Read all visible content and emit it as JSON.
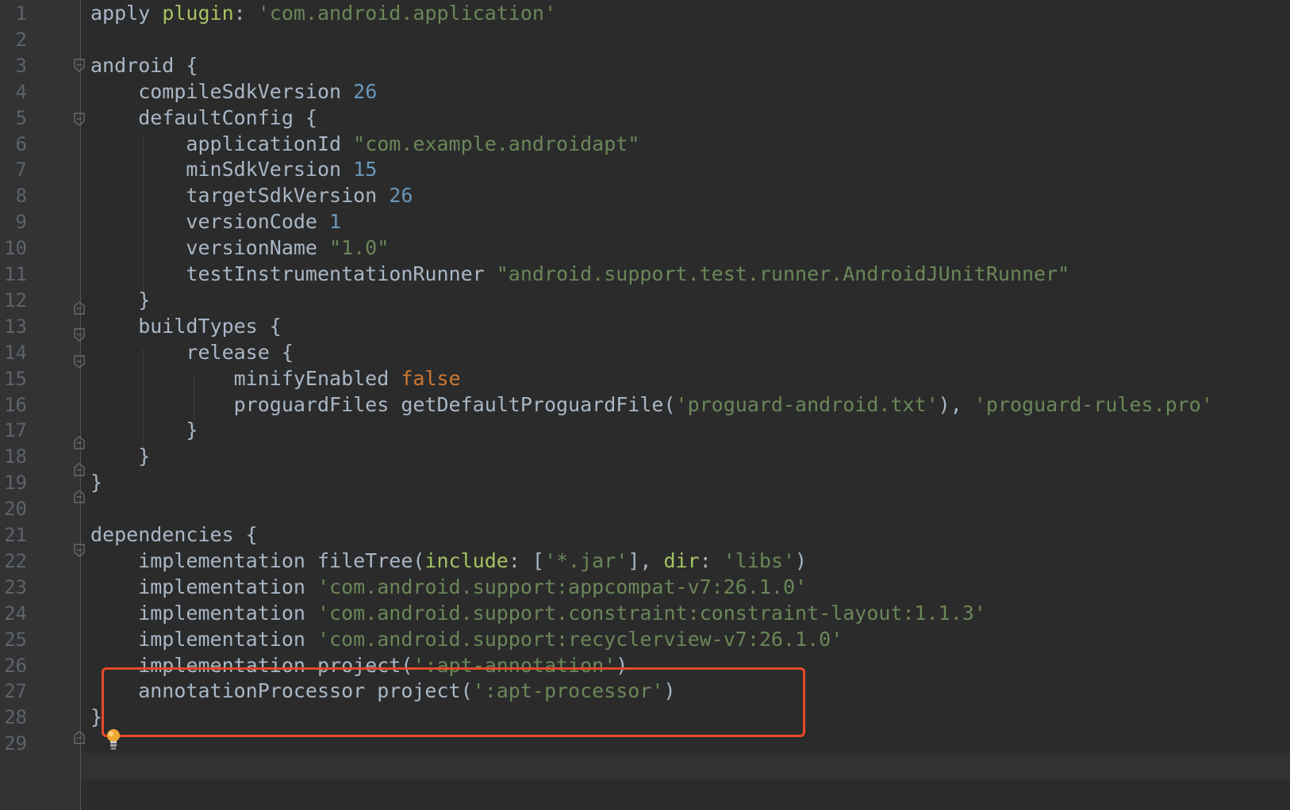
{
  "editor": {
    "lines": [
      {
        "n": "1",
        "tokens": [
          {
            "t": "apply ",
            "c": ""
          },
          {
            "t": "plugin",
            "c": "t-plg"
          },
          {
            "t": ": ",
            "c": ""
          },
          {
            "t": "'com.android.application'",
            "c": "t-str"
          }
        ]
      },
      {
        "n": "2",
        "tokens": []
      },
      {
        "n": "3",
        "tokens": [
          {
            "t": "android {",
            "c": ""
          }
        ]
      },
      {
        "n": "4",
        "tokens": [
          {
            "t": "    compileSdkVersion ",
            "c": ""
          },
          {
            "t": "26",
            "c": "t-num"
          }
        ]
      },
      {
        "n": "5",
        "tokens": [
          {
            "t": "    defaultConfig {",
            "c": ""
          }
        ]
      },
      {
        "n": "6",
        "tokens": [
          {
            "t": "        applicationId ",
            "c": ""
          },
          {
            "t": "\"com.example.androidapt\"",
            "c": "t-str"
          }
        ]
      },
      {
        "n": "7",
        "tokens": [
          {
            "t": "        minSdkVersion ",
            "c": ""
          },
          {
            "t": "15",
            "c": "t-num"
          }
        ]
      },
      {
        "n": "8",
        "tokens": [
          {
            "t": "        targetSdkVersion ",
            "c": ""
          },
          {
            "t": "26",
            "c": "t-num"
          }
        ]
      },
      {
        "n": "9",
        "tokens": [
          {
            "t": "        versionCode ",
            "c": ""
          },
          {
            "t": "1",
            "c": "t-num"
          }
        ]
      },
      {
        "n": "10",
        "tokens": [
          {
            "t": "        versionName ",
            "c": ""
          },
          {
            "t": "\"1.0\"",
            "c": "t-str"
          }
        ]
      },
      {
        "n": "11",
        "tokens": [
          {
            "t": "        testInstrumentationRunner ",
            "c": ""
          },
          {
            "t": "\"android.support.test.runner.AndroidJUnitRunner\"",
            "c": "t-str"
          }
        ]
      },
      {
        "n": "12",
        "tokens": [
          {
            "t": "    }",
            "c": ""
          }
        ]
      },
      {
        "n": "13",
        "tokens": [
          {
            "t": "    buildTypes {",
            "c": ""
          }
        ]
      },
      {
        "n": "14",
        "tokens": [
          {
            "t": "        release {",
            "c": ""
          }
        ]
      },
      {
        "n": "15",
        "tokens": [
          {
            "t": "            minifyEnabled ",
            "c": ""
          },
          {
            "t": "false",
            "c": "t-kw"
          }
        ]
      },
      {
        "n": "16",
        "tokens": [
          {
            "t": "            proguardFiles getDefaultProguardFile(",
            "c": ""
          },
          {
            "t": "'proguard-android.txt'",
            "c": "t-str"
          },
          {
            "t": "), ",
            "c": ""
          },
          {
            "t": "'proguard-rules.pro'",
            "c": "t-str"
          }
        ]
      },
      {
        "n": "17",
        "tokens": [
          {
            "t": "        }",
            "c": ""
          }
        ]
      },
      {
        "n": "18",
        "tokens": [
          {
            "t": "    }",
            "c": ""
          }
        ]
      },
      {
        "n": "19",
        "tokens": [
          {
            "t": "}",
            "c": ""
          }
        ]
      },
      {
        "n": "20",
        "tokens": []
      },
      {
        "n": "21",
        "tokens": [
          {
            "t": "dependencies {",
            "c": ""
          }
        ]
      },
      {
        "n": "22",
        "tokens": [
          {
            "t": "    implementation fileTree(",
            "c": ""
          },
          {
            "t": "include",
            "c": "t-plg"
          },
          {
            "t": ": [",
            "c": ""
          },
          {
            "t": "'*.jar'",
            "c": "t-str"
          },
          {
            "t": "], ",
            "c": ""
          },
          {
            "t": "dir",
            "c": "t-plg"
          },
          {
            "t": ": ",
            "c": ""
          },
          {
            "t": "'libs'",
            "c": "t-str"
          },
          {
            "t": ")",
            "c": ""
          }
        ]
      },
      {
        "n": "23",
        "tokens": [
          {
            "t": "    implementation ",
            "c": ""
          },
          {
            "t": "'com.android.support:appcompat-v7:26.1.0'",
            "c": "t-str"
          }
        ]
      },
      {
        "n": "24",
        "tokens": [
          {
            "t": "    implementation ",
            "c": ""
          },
          {
            "t": "'com.android.support.constraint:constraint-layout:1.1.3'",
            "c": "t-str"
          }
        ]
      },
      {
        "n": "25",
        "tokens": [
          {
            "t": "    implementation ",
            "c": ""
          },
          {
            "t": "'com.android.support:recyclerview-v7:26.1.0'",
            "c": "t-str"
          }
        ]
      },
      {
        "n": "26",
        "tokens": [
          {
            "t": "    implementation project(",
            "c": ""
          },
          {
            "t": "':apt-annotation'",
            "c": "t-str"
          },
          {
            "t": ")",
            "c": ""
          }
        ]
      },
      {
        "n": "27",
        "tokens": [
          {
            "t": "    annotationProcessor project(",
            "c": ""
          },
          {
            "t": "':apt-processor'",
            "c": "t-str"
          },
          {
            "t": ")",
            "c": ""
          }
        ]
      },
      {
        "n": "28",
        "tokens": [
          {
            "t": "}",
            "c": ""
          }
        ]
      },
      {
        "n": "29",
        "tokens": []
      }
    ],
    "colors": {
      "background": "#2b2b2b",
      "text": "#a9b7c6",
      "string": "#6a8759",
      "number": "#6897bb",
      "keyword": "#cc7832",
      "named_arg": "#a5c261",
      "highlight_box": "#e8492a"
    }
  }
}
